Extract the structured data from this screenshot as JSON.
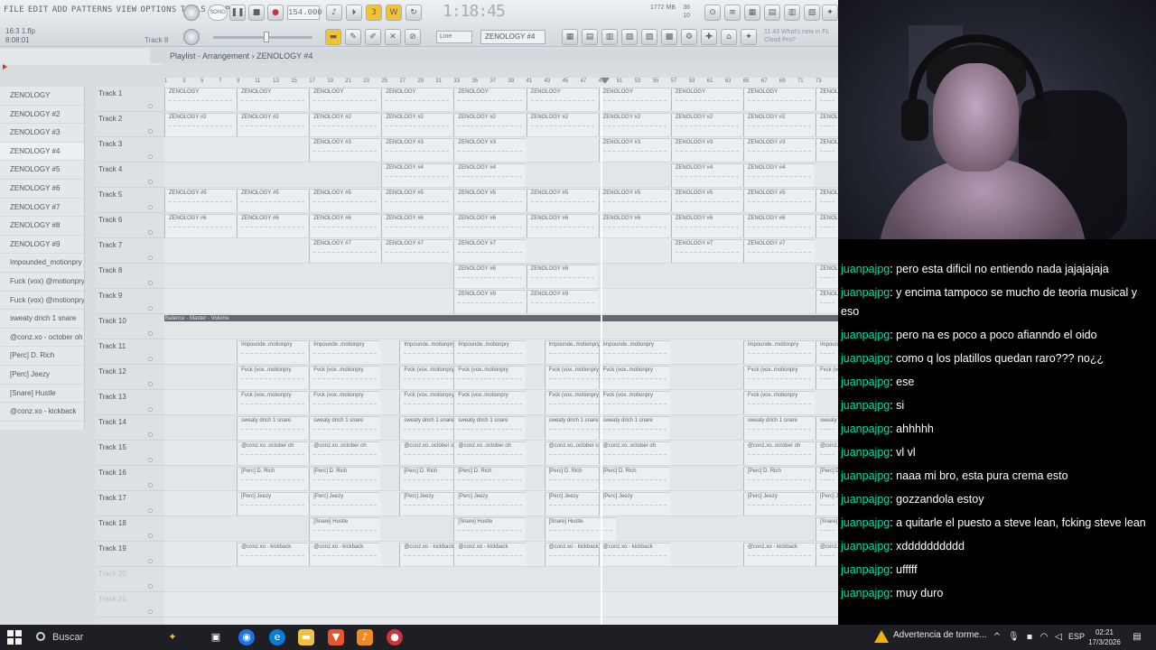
{
  "menubar": {
    "menus": [
      "FILE",
      "EDIT",
      "ADD",
      "PATTERNS",
      "VIEW",
      "OPTIONS",
      "TOOLS",
      "HELP"
    ],
    "song_mode_label": "SONG",
    "tempo": "154.000",
    "time_display": "1:18:45",
    "project_info_line1": "16:3 1.flp",
    "project_info_line2": "8:08:01",
    "hint_track": "Track 8",
    "pattern_selector": "ZENOLOGY #4",
    "snap_selector": "Line",
    "memory": "1772 MB",
    "cpu_top": "36",
    "cpu_bottom": "10",
    "news_line1": "11:43 What's new in FL",
    "news_line2": "Cloud Pro?"
  },
  "playlist": {
    "title": "Playlist - Arrangement",
    "separator": "›",
    "pattern": "ZENOLOGY #4",
    "ruler_ticks": [
      "1",
      "3",
      "5",
      "7",
      "9",
      "11",
      "13",
      "15",
      "17",
      "19",
      "21",
      "23",
      "25",
      "27",
      "29",
      "31",
      "33",
      "35",
      "37",
      "39",
      "41",
      "43",
      "45",
      "47",
      "49",
      "51",
      "53",
      "55",
      "57",
      "59",
      "61",
      "63",
      "65",
      "67",
      "69",
      "71",
      "73"
    ],
    "automation_label": "Balance - Master - Volume"
  },
  "browser": {
    "items": [
      "ZENOLOGY",
      "ZENOLOGY #2",
      "ZENOLOGY #3",
      "ZENOLOGY #4",
      "ZENOLOGY #5",
      "ZENOLOGY #6",
      "ZENOLOGY #7",
      "ZENOLOGY #8",
      "ZENOLOGY #9",
      "Impounded_motionpry",
      "Fuck (vox) @motionpry",
      "Fuck (vox) @motionpry",
      "sweaty drich 1 snare",
      "@conz.xo - october oh",
      "[Perc] D. Rich",
      "[Perc] Jeezy",
      "[Snare] Hustle",
      "@conz.xo - kickback"
    ]
  },
  "tracks": [
    "Track 1",
    "Track 2",
    "Track 3",
    "Track 4",
    "Track 5",
    "Track 6",
    "Track 7",
    "Track 8",
    "Track 9",
    "Track 10",
    "Track 11",
    "Track 12",
    "Track 13",
    "Track 14",
    "Track 15",
    "Track 16",
    "Track 17",
    "Track 18",
    "Track 19",
    "Track 20",
    "Track 21"
  ],
  "clips": [
    {
      "track": 0,
      "label": "ZENOLOGY",
      "bars": [
        1,
        9,
        17,
        25,
        33,
        41,
        49,
        57,
        65,
        73
      ]
    },
    {
      "track": 1,
      "label": "ZENOLOGY #2",
      "bars": [
        1,
        9,
        17,
        25,
        33,
        41,
        49,
        57,
        65,
        73
      ]
    },
    {
      "track": 2,
      "label": "ZENOLOGY #3",
      "bars": [
        17,
        25,
        33,
        49,
        57,
        65,
        73
      ]
    },
    {
      "track": 3,
      "label": "ZENOLOGY #4",
      "bars": [
        25,
        33,
        57,
        65
      ]
    },
    {
      "track": 4,
      "label": "ZENOLOGY #5",
      "bars": [
        1,
        9,
        17,
        25,
        33,
        41,
        49,
        57,
        65,
        73
      ]
    },
    {
      "track": 5,
      "label": "ZENOLOGY #6",
      "bars": [
        1,
        9,
        17,
        25,
        33,
        41,
        49,
        57,
        65,
        73
      ]
    },
    {
      "track": 6,
      "label": "ZENOLOGY #7",
      "bars": [
        17,
        25,
        33,
        57,
        65
      ]
    },
    {
      "track": 7,
      "label": "ZENOLOGY #8",
      "bars": [
        33,
        41,
        73
      ]
    },
    {
      "track": 8,
      "label": "ZENOLOGY #9",
      "bars": [
        33,
        41,
        73
      ]
    },
    {
      "track": 10,
      "label": "Impounde..motionpry",
      "bars": [
        9,
        17,
        27,
        33,
        43,
        49,
        65,
        73
      ]
    },
    {
      "track": 11,
      "label": "Fvck (vox..motionpry",
      "bars": [
        9,
        17,
        27,
        33,
        43,
        49,
        65,
        73
      ]
    },
    {
      "track": 12,
      "label": "Fvck (vox..motionpry",
      "bars": [
        9,
        17,
        27,
        33,
        43,
        49,
        65
      ]
    },
    {
      "track": 13,
      "label": "sweaty drich 1 snare",
      "bars": [
        9,
        17,
        27,
        33,
        43,
        49,
        65,
        73
      ]
    },
    {
      "track": 14,
      "label": "@conz.xo..october oh",
      "bars": [
        9,
        17,
        27,
        33,
        43,
        49,
        65,
        73
      ]
    },
    {
      "track": 15,
      "label": "[Perc] D. Rich",
      "bars": [
        9,
        17,
        27,
        33,
        43,
        49,
        65,
        73
      ]
    },
    {
      "track": 16,
      "label": "[Perc] Jeezy",
      "bars": [
        9,
        17,
        27,
        33,
        43,
        49,
        65,
        73
      ]
    },
    {
      "track": 17,
      "label": "[Snare] Hustle",
      "bars": [
        17,
        33,
        43,
        73
      ]
    },
    {
      "track": 18,
      "label": "@conz.xo - kickback",
      "bars": [
        9,
        17,
        27,
        33,
        43,
        49,
        65,
        73
      ]
    }
  ],
  "chat": [
    {
      "user": "juanpajpg",
      "text": ": pero esta dificil no entiendo nada jajajajaja"
    },
    {
      "user": "juanpajpg",
      "text": ": y encima tampoco se mucho de teoria musical y eso"
    },
    {
      "user": "juanpajpg",
      "text": ": pero na es poco a poco afianndo el oido"
    },
    {
      "user": "juanpajpg",
      "text": ": como q los platillos quedan raro??? no¿¿"
    },
    {
      "user": "juanpajpg",
      "text": ": ese"
    },
    {
      "user": "juanpajpg",
      "text": ": si"
    },
    {
      "user": "juanpajpg",
      "text": ": ahhhhh"
    },
    {
      "user": "juanpajpg",
      "text": ": vl vl"
    },
    {
      "user": "juanpajpg",
      "text": ": naaa mi bro, esta pura crema esto"
    },
    {
      "user": "juanpajpg",
      "text": ": gozzandola estoy"
    },
    {
      "user": "juanpajpg",
      "text": ": a quitarle el puesto a steve lean, fcking steve lean"
    },
    {
      "user": "juanpajpg",
      "text": ": xdddddddddd"
    },
    {
      "user": "juanpajpg",
      "text": ": ufffff"
    },
    {
      "user": "juanpajpg",
      "text": ": muy duro"
    }
  ],
  "taskbar": {
    "search_label": "Buscar",
    "weather_label": "Advertencia de torme...",
    "language": "ESP",
    "time": "02:21",
    "date": "17/3/2026"
  },
  "colors": {
    "chat_username": "#00e0a8",
    "fl_background": "#d9dde0",
    "record_red": "#d0333a"
  }
}
